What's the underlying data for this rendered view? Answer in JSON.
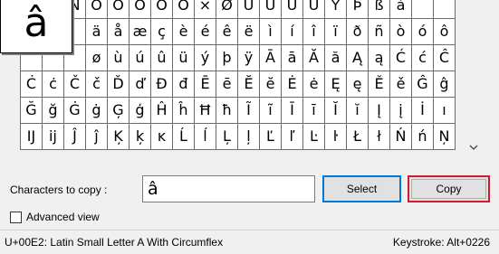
{
  "magnifier": {
    "char": "â"
  },
  "grid": {
    "rows": [
      [
        "",
        "Ð",
        "Ñ",
        "Ò",
        "Ó",
        "Ô",
        "Õ",
        "Ö",
        "×",
        "Ø",
        "Ù",
        "Ú",
        "Û",
        "Ü",
        "Ý",
        "Þ",
        "ß",
        "à"
      ],
      [
        "",
        "",
        "",
        "ä",
        "å",
        "æ",
        "ç",
        "è",
        "é",
        "ê",
        "ë",
        "ì",
        "í",
        "î",
        "ï",
        "ð",
        "ñ",
        "ò",
        "ó",
        "ô"
      ],
      [
        "",
        "",
        "",
        "ø",
        "ù",
        "ú",
        "û",
        "ü",
        "ý",
        "þ",
        "ÿ",
        "Ā",
        "ā",
        "Ă",
        "ă",
        "Ą",
        "ą",
        "Ć",
        "ć",
        "Ĉ"
      ],
      [
        "Ċ",
        "ċ",
        "Č",
        "č",
        "Ď",
        "ď",
        "Đ",
        "đ",
        "Ē",
        "ē",
        "Ĕ",
        "ĕ",
        "Ė",
        "ė",
        "Ę",
        "ę",
        "Ě",
        "ě",
        "Ĝ",
        "ĝ"
      ],
      [
        "Ğ",
        "ğ",
        "Ġ",
        "ġ",
        "Ģ",
        "ģ",
        "Ĥ",
        "ĥ",
        "Ħ",
        "ħ",
        "Ĩ",
        "ĩ",
        "Ī",
        "ī",
        "Ĭ",
        "ĭ",
        "Į",
        "į",
        "İ",
        "ı"
      ],
      [
        "Ĳ",
        "ĳ",
        "Ĵ",
        "ĵ",
        "Ķ",
        "ķ",
        "ĸ",
        "Ĺ",
        "ĺ",
        "Ļ",
        "ļ",
        "Ľ",
        "ľ",
        "Ŀ",
        "ŀ",
        "Ł",
        "ł",
        "Ń",
        "ń",
        "Ņ"
      ]
    ]
  },
  "copy": {
    "label": "Characters to copy :",
    "value": "â",
    "select_label": "Select",
    "copy_label": "Copy"
  },
  "advanced": {
    "label": "Advanced view"
  },
  "status": {
    "char_info": "U+00E2: Latin Small Letter A With Circumflex",
    "keystroke": "Keystroke: Alt+0226"
  }
}
